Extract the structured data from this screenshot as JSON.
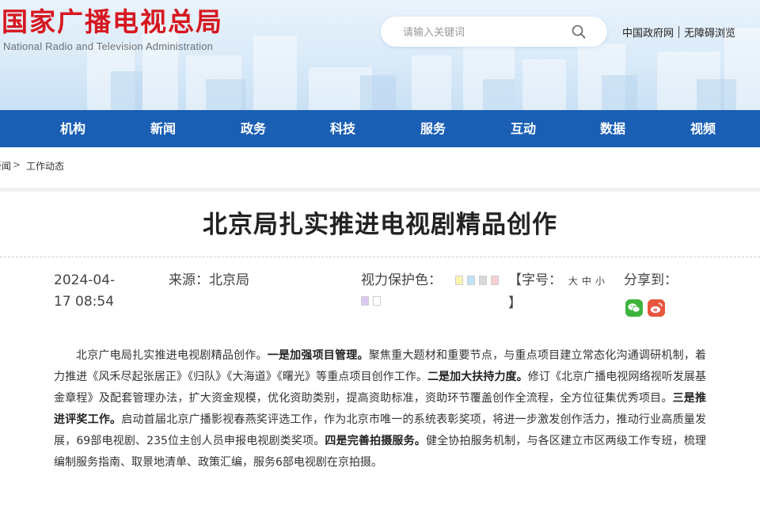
{
  "header": {
    "logo_cn": "国家广播电视总局",
    "logo_en": "National Radio and Television Administration",
    "search_placeholder": "请输入关键词",
    "links": [
      "中国政府网",
      "无障碍浏览"
    ]
  },
  "nav": {
    "items": [
      "机构",
      "新闻",
      "政务",
      "科技",
      "服务",
      "互动",
      "数据",
      "视频"
    ]
  },
  "breadcrumb": {
    "first": "新闻",
    "separator": ">",
    "current": "工作动态"
  },
  "article": {
    "title": "北京局扎实推进电视剧精品创作",
    "date_line1": "2024-04-",
    "date_line2": "17 08:54",
    "source": "来源：北京局",
    "vision_label": "视力保护色：",
    "fontsize_label": "【字号：",
    "fontsize_options": [
      "大",
      "中",
      "小"
    ],
    "fontsize_close": "】",
    "share_label": "分享到：",
    "swatch_colors": [
      "#fbf5b0",
      "#bfe3f7",
      "#d9d9d9",
      "#f7cfd3",
      "#d9c8ee",
      "#ffffff"
    ],
    "body": [
      {
        "text": "北京广电局扎实推进电视剧精品创作。",
        "bold": false
      },
      {
        "text": "一是加强项目管理。",
        "bold": true
      },
      {
        "text": "聚焦重大题材和重要节点，与重点项目建立常态化沟通调研机制，着力推进《风禾尽起张居正》《归队》《大海道》《曙光》等重点项目创作工作。",
        "bold": false
      },
      {
        "text": "二是加大扶持力度。",
        "bold": true
      },
      {
        "text": "修订《北京广播电视网络视听发展基金章程》及配套管理办法，扩大资金规模，优化资助类别，提高资助标准，资助环节覆盖创作全流程，全方位征集优秀项目。",
        "bold": false
      },
      {
        "text": "三是推进评奖工作。",
        "bold": true
      },
      {
        "text": "启动首届北京广播影视春燕奖评选工作，作为北京市唯一的系统表彰奖项，将进一步激发创作活力，推动行业高质量发展，69部电视剧、235位主创人员申报电视剧类奖项。",
        "bold": false
      },
      {
        "text": "四是完善拍摄服务。",
        "bold": true
      },
      {
        "text": "健全协拍服务机制，与各区建立市区两级工作专班，梳理编制服务指南、取景地清单、政策汇编，服务6部电视剧在京拍摄。",
        "bold": false
      }
    ]
  },
  "colors": {
    "brand_red": "#d7171f",
    "nav_blue": "#1a5fb4",
    "wechat_green": "#3fb43c",
    "weibo_red": "#e8563f"
  },
  "icons": [
    "search-icon",
    "wechat-icon",
    "weibo-icon"
  ]
}
